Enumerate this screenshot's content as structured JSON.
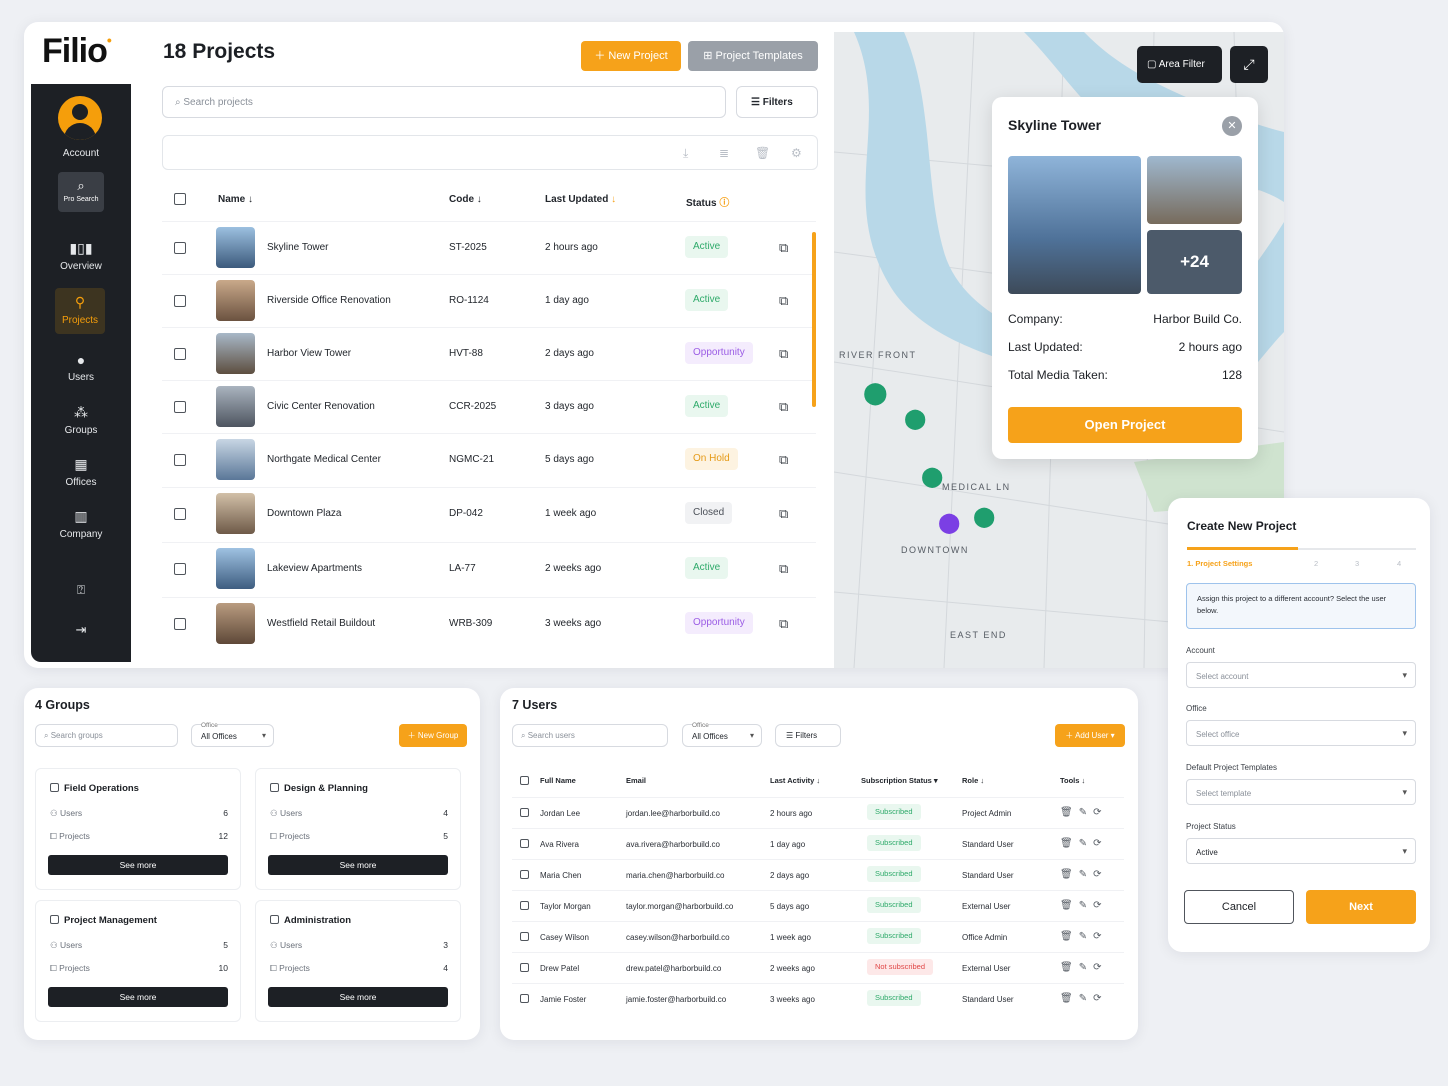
{
  "brand": {
    "logo": "Filio"
  },
  "sidebar": {
    "account": "Account",
    "pro_search": "Pro Search",
    "items": [
      "Overview",
      "Projects",
      "Users",
      "Groups",
      "Offices",
      "Company"
    ]
  },
  "projects": {
    "title": "18 Projects",
    "new_project": "New Project",
    "templates": "Project Templates",
    "search_placeholder": "Search projects",
    "filters": "Filters",
    "headers": {
      "name": "Name",
      "code": "Code",
      "updated": "Last Updated",
      "status": "Status"
    },
    "rows": [
      {
        "name": "Skyline Tower",
        "code": "ST-2025",
        "updated": "2 hours ago",
        "status": "Active"
      },
      {
        "name": "Riverside Office Renovation",
        "code": "RO-1124",
        "updated": "1 day ago",
        "status": "Active"
      },
      {
        "name": "Harbor View Tower",
        "code": "HVT-88",
        "updated": "2 days ago",
        "status": "Opportunity"
      },
      {
        "name": "Civic Center Renovation",
        "code": "CCR-2025",
        "updated": "3 days ago",
        "status": "Active"
      },
      {
        "name": "Northgate Medical Center",
        "code": "NGMC-21",
        "updated": "5 days ago",
        "status": "On Hold"
      },
      {
        "name": "Downtown Plaza",
        "code": "DP-042",
        "updated": "1 week ago",
        "status": "Closed"
      },
      {
        "name": "Lakeview Apartments",
        "code": "LA-77",
        "updated": "2 weeks ago",
        "status": "Active"
      },
      {
        "name": "Westfield Retail Buildout",
        "code": "WRB-309",
        "updated": "3 weeks ago",
        "status": "Opportunity"
      }
    ]
  },
  "map": {
    "area_filter": "Area Filter",
    "labels": {
      "river": "RIVER FRONT",
      "medical": "MEDICAL LN",
      "downtown": "DOWNTOWN",
      "east": "EAST END"
    },
    "popup": {
      "title": "Skyline Tower",
      "more_media": "+24",
      "company_label": "Company:",
      "company": "Harbor Build Co.",
      "updated_label": "Last Updated:",
      "updated": "2 hours ago",
      "media_label": "Total Media Taken:",
      "media": "128",
      "open": "Open Project"
    }
  },
  "groups": {
    "title": "4 Groups",
    "search_placeholder": "Search groups",
    "office_label": "Office",
    "office_value": "All Offices",
    "new_group": "New Group",
    "users_label": "Users",
    "projects_label": "Projects",
    "see_more": "See more",
    "items": [
      {
        "name": "Field Operations",
        "users": "6",
        "projects": "12"
      },
      {
        "name": "Design & Planning",
        "users": "4",
        "projects": "5"
      },
      {
        "name": "Project Management",
        "users": "5",
        "projects": "10"
      },
      {
        "name": "Administration",
        "users": "3",
        "projects": "4"
      }
    ]
  },
  "users": {
    "title": "7 Users",
    "search_placeholder": "Search users",
    "office_label": "Office",
    "office_value": "All Offices",
    "filters": "Filters",
    "add_user": "Add User",
    "headers": {
      "name": "Full Name",
      "email": "Email",
      "activity": "Last Activity",
      "sub": "Subscription Status",
      "role": "Role",
      "tools": "Tools"
    },
    "rows": [
      {
        "name": "Jordan Lee",
        "email": "jordan.lee@harborbuild.co",
        "activity": "2 hours ago",
        "sub": "Subscribed",
        "role": "Project Admin"
      },
      {
        "name": "Ava Rivera",
        "email": "ava.rivera@harborbuild.co",
        "activity": "1 day ago",
        "sub": "Subscribed",
        "role": "Standard User"
      },
      {
        "name": "Maria Chen",
        "email": "maria.chen@harborbuild.co",
        "activity": "2 days ago",
        "sub": "Subscribed",
        "role": "Standard User"
      },
      {
        "name": "Taylor Morgan",
        "email": "taylor.morgan@harborbuild.co",
        "activity": "5 days ago",
        "sub": "Subscribed",
        "role": "External User"
      },
      {
        "name": "Casey Wilson",
        "email": "casey.wilson@harborbuild.co",
        "activity": "1 week ago",
        "sub": "Subscribed",
        "role": "Office Admin"
      },
      {
        "name": "Drew Patel",
        "email": "drew.patel@harborbuild.co",
        "activity": "2 weeks ago",
        "sub": "Not subscribed",
        "role": "External User"
      },
      {
        "name": "Jamie Foster",
        "email": "jamie.foster@harborbuild.co",
        "activity": "3 weeks ago",
        "sub": "Subscribed",
        "role": "Standard User"
      }
    ]
  },
  "create": {
    "title": "Create New Project",
    "step1": "1. Project Settings",
    "step2": "2",
    "step3": "3",
    "step4": "4",
    "info": "Assign this project to a different account? Select the user below.",
    "account_label": "Account",
    "account_ph": "Select account",
    "office_label": "Office",
    "office_ph": "Select office",
    "template_label": "Default Project Templates",
    "template_ph": "Select template",
    "status_label": "Project Status",
    "status_value": "Active",
    "cancel": "Cancel",
    "next": "Next"
  }
}
